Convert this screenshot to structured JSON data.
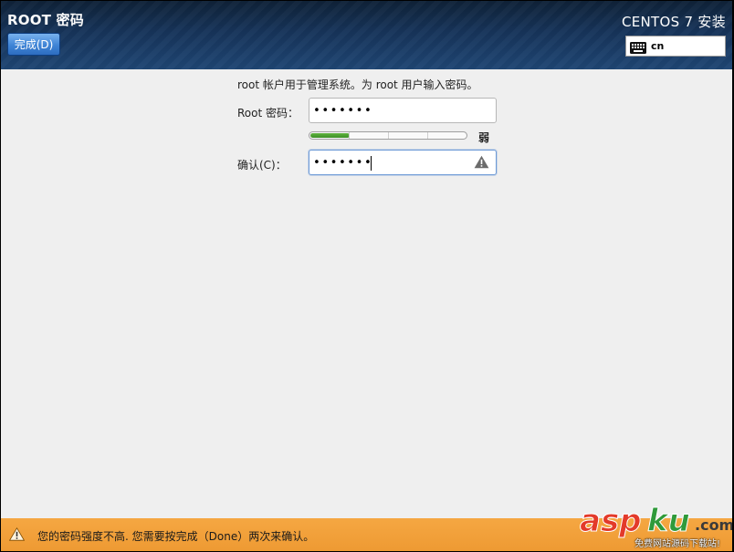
{
  "header": {
    "title": "ROOT 密码",
    "done_button": "完成(D)",
    "product": "CENTOS 7 安装",
    "keyboard_layout": "cn",
    "keyboard_icon": "keyboard-icon"
  },
  "form": {
    "description": "root 帐户用于管理系统。为 root 用户输入密码。",
    "root_password_label": "Root 密码：",
    "root_password_value": "•••••••",
    "confirm_label": "确认(C)：",
    "confirm_value": "•••••••",
    "confirm_warning_icon": "warning-icon",
    "strength": {
      "label": "弱",
      "level": 0.25
    }
  },
  "status_bar": {
    "icon": "warning-icon",
    "message": "您的密码强度不高. 您需要按完成（Done）两次来确认。"
  },
  "watermark": {
    "brand_a": "asp",
    "brand_b": "ku",
    "brand_c": ".com",
    "subtitle": "免费网站源码下载站!"
  },
  "colors": {
    "header_dark": "#0f2238",
    "done_button": "#3f84d6",
    "strength_fill": "#4aa32f",
    "warning_bar": "#f0a038"
  }
}
